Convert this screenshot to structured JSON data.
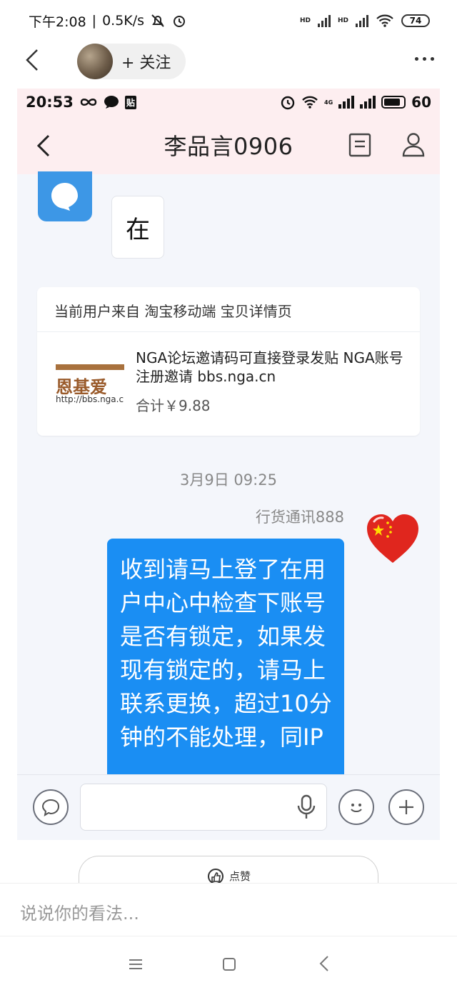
{
  "outer_status": {
    "time": "下午2:08",
    "speed": "0.5K/s",
    "battery": "74",
    "hd1": "HD",
    "hd2": "HD"
  },
  "outer_nav": {
    "follow_label": "+ 关注"
  },
  "inner_status": {
    "time": "20:53",
    "tie_label": "贴",
    "network": "4G",
    "battery": "60"
  },
  "inner_nav": {
    "title": "李品言0906"
  },
  "chat": {
    "first_message": "在",
    "product_card": {
      "source": "当前用户来自 淘宝移动端 宝贝详情页",
      "name": "NGA论坛邀请码可直接登录发贴 NGA账号注册邀请 bbs.nga.cn",
      "price": "合计￥9.88",
      "thumb_brand": "恩基爱",
      "thumb_url": "http://bbs.nga.c"
    },
    "timestamp": "3月9日 09:25",
    "sender": "行货通讯888",
    "reply": "收到请马上登了在用户中心中检查下账号是否有锁定，如果发现有锁定的，请马上联系更换，超过10分钟的不能处理，同IP"
  },
  "like_button": {
    "label": "点赞"
  },
  "comment": {
    "placeholder": "说说你的看法..."
  },
  "colors": {
    "accent_blue": "#1a8ef3",
    "inner_header": "#fdeef0",
    "chat_bg": "#f4f6fb"
  }
}
